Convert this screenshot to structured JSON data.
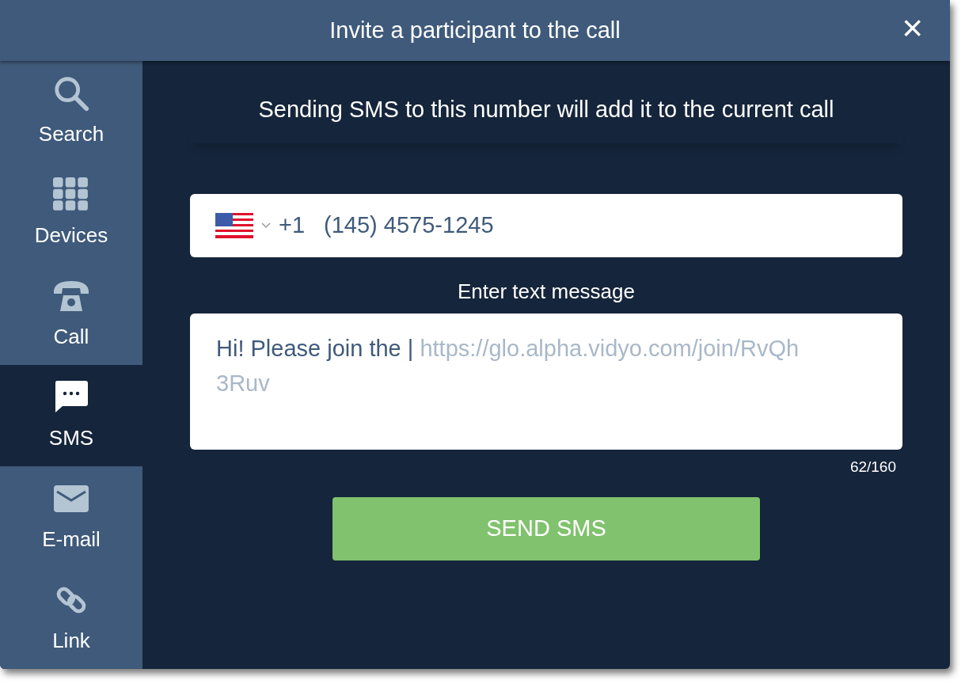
{
  "window": {
    "title": "Invite a participant to the call",
    "close": "×"
  },
  "sidebar": {
    "items": [
      {
        "label": "Search",
        "kind": "search",
        "selected": false
      },
      {
        "label": "Devices",
        "kind": "devices",
        "selected": false
      },
      {
        "label": "Call",
        "kind": "call",
        "selected": false
      },
      {
        "label": "SMS",
        "kind": "sms",
        "selected": true
      },
      {
        "label": "E-mail",
        "kind": "email",
        "selected": false
      },
      {
        "label": "Link",
        "kind": "link",
        "selected": false
      }
    ]
  },
  "info": "Sending SMS to this number will add it to the current call",
  "phone": {
    "code": "+1",
    "value": "(145) 4575-1245"
  },
  "message": {
    "label": "Enter text message",
    "text": "Hi! Please join the |",
    "link": "https://glo.alpha.vidyo.com/join/RvQh3Ruv",
    "counter": "62/160"
  },
  "send_button": "SEND SMS"
}
